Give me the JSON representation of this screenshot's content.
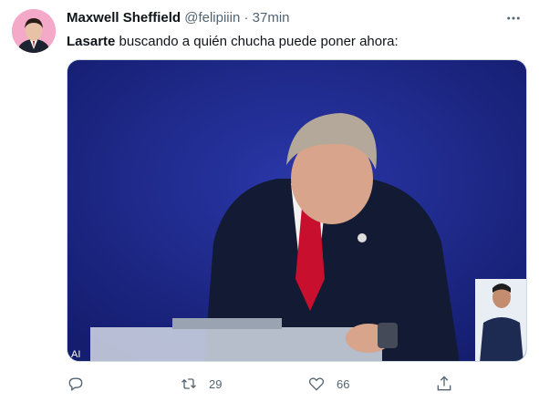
{
  "tweet": {
    "author_name": "Maxwell Sheffield",
    "handle": "@felipiiin",
    "separator": "·",
    "time": "37min",
    "text_bold": "Lasarte",
    "text_rest": " buscando a quién chucha puede poner ahora:",
    "media_overlay_text": "AI",
    "actions": {
      "reply_count": "",
      "retweet_count": "29",
      "like_count": "66"
    }
  },
  "icons": {
    "more": "more-horizontal-icon",
    "reply": "reply-icon",
    "retweet": "retweet-icon",
    "like": "heart-icon",
    "share": "share-icon"
  },
  "colors": {
    "text_primary": "#0f1419",
    "text_secondary": "#536471",
    "media_background": "#1f2a8a"
  }
}
